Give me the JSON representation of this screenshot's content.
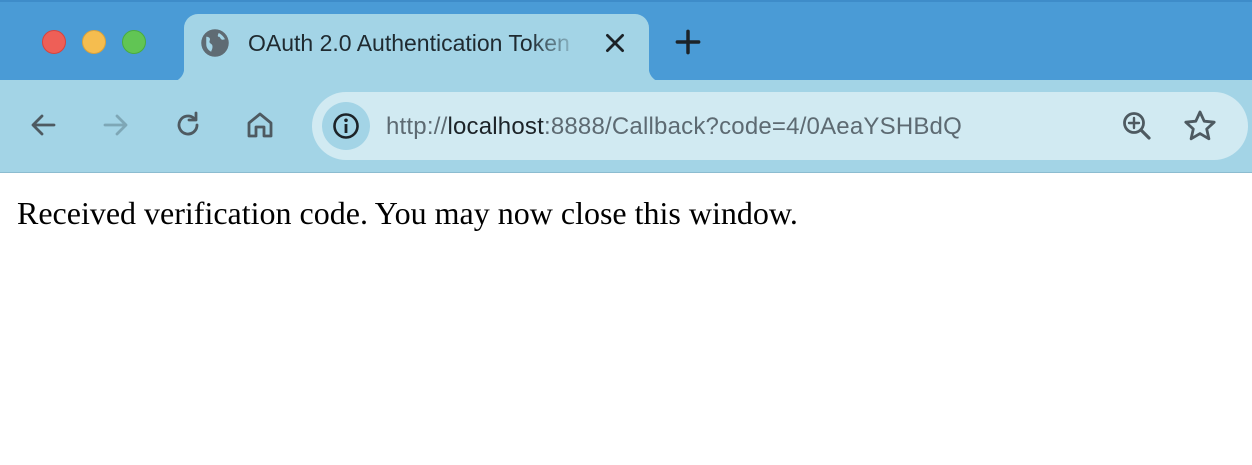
{
  "window": {
    "controls": {
      "close_color": "#ee5f57",
      "minimize_color": "#f5bd4f",
      "maximize_color": "#61c554"
    }
  },
  "tab": {
    "title": "OAuth 2.0 Authentication Token",
    "favicon": "globe-icon",
    "close_icon": "close-icon"
  },
  "new_tab_icon": "plus-icon",
  "toolbar": {
    "back_icon": "arrow-left-icon",
    "forward_icon": "arrow-right-icon",
    "reload_icon": "reload-icon",
    "home_icon": "home-icon"
  },
  "address_bar": {
    "site_info_icon": "info-icon",
    "url_scheme": "http://",
    "url_host": "localhost",
    "url_rest": ":8888/Callback?code=4/0AeaYSHBdQ",
    "zoom_icon": "zoom-in-icon",
    "bookmark_icon": "star-icon"
  },
  "page": {
    "message": "Received verification code. You may now close this window."
  },
  "colors": {
    "titlebar": "#4a9bd6",
    "toolbar": "#a3d4e6",
    "omnibox": "#d1eaf2"
  }
}
